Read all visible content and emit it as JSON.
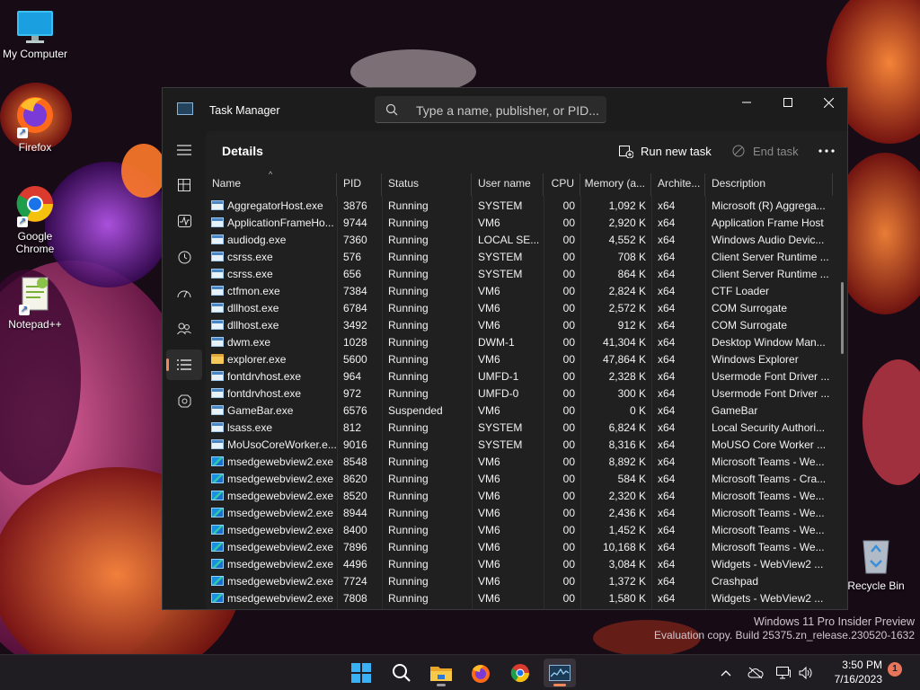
{
  "desktop": {
    "icons": [
      {
        "label": "My Computer"
      },
      {
        "label": "Firefox"
      },
      {
        "label": "Google Chrome"
      },
      {
        "label": "Notepad++"
      },
      {
        "label": "Recycle Bin"
      }
    ],
    "watermark": {
      "line1": "Windows 11 Pro Insider Preview",
      "line2": "Evaluation copy. Build 25375.zn_release.230520-1632"
    }
  },
  "window": {
    "title": "Task Manager",
    "search_placeholder": "Type a name, publisher, or PID...",
    "page_title": "Details",
    "run_new_task": "Run new task",
    "end_task": "End task",
    "accent_color": "#f08a5d"
  },
  "nav": [
    {
      "icon": "hamburger-icon"
    },
    {
      "icon": "processes-icon"
    },
    {
      "icon": "performance-icon"
    },
    {
      "icon": "app-history-icon"
    },
    {
      "icon": "startup-apps-icon"
    },
    {
      "icon": "users-icon"
    },
    {
      "icon": "details-icon",
      "active": true
    },
    {
      "icon": "services-icon"
    },
    {
      "icon": "settings-icon"
    }
  ],
  "table": {
    "columns": [
      "Name",
      "PID",
      "Status",
      "User name",
      "CPU",
      "Memory (a...",
      "Archite...",
      "Description"
    ],
    "sorted_column": "Name",
    "rows": [
      {
        "icon": "win",
        "name": "AggregatorHost.exe",
        "pid": "3876",
        "status": "Running",
        "user": "SYSTEM",
        "cpu": "00",
        "mem": "1,092 K",
        "arch": "x64",
        "desc": "Microsoft (R) Aggrega..."
      },
      {
        "icon": "win",
        "name": "ApplicationFrameHo...",
        "pid": "9744",
        "status": "Running",
        "user": "VM6",
        "cpu": "00",
        "mem": "2,920 K",
        "arch": "x64",
        "desc": "Application Frame Host"
      },
      {
        "icon": "win",
        "name": "audiodg.exe",
        "pid": "7360",
        "status": "Running",
        "user": "LOCAL SE...",
        "cpu": "00",
        "mem": "4,552 K",
        "arch": "x64",
        "desc": "Windows Audio Devic..."
      },
      {
        "icon": "win",
        "name": "csrss.exe",
        "pid": "576",
        "status": "Running",
        "user": "SYSTEM",
        "cpu": "00",
        "mem": "708 K",
        "arch": "x64",
        "desc": "Client Server Runtime ..."
      },
      {
        "icon": "win",
        "name": "csrss.exe",
        "pid": "656",
        "status": "Running",
        "user": "SYSTEM",
        "cpu": "00",
        "mem": "864 K",
        "arch": "x64",
        "desc": "Client Server Runtime ..."
      },
      {
        "icon": "win",
        "name": "ctfmon.exe",
        "pid": "7384",
        "status": "Running",
        "user": "VM6",
        "cpu": "00",
        "mem": "2,824 K",
        "arch": "x64",
        "desc": "CTF Loader"
      },
      {
        "icon": "win",
        "name": "dllhost.exe",
        "pid": "6784",
        "status": "Running",
        "user": "VM6",
        "cpu": "00",
        "mem": "2,572 K",
        "arch": "x64",
        "desc": "COM Surrogate"
      },
      {
        "icon": "win",
        "name": "dllhost.exe",
        "pid": "3492",
        "status": "Running",
        "user": "VM6",
        "cpu": "00",
        "mem": "912 K",
        "arch": "x64",
        "desc": "COM Surrogate"
      },
      {
        "icon": "win",
        "name": "dwm.exe",
        "pid": "1028",
        "status": "Running",
        "user": "DWM-1",
        "cpu": "00",
        "mem": "41,304 K",
        "arch": "x64",
        "desc": "Desktop Window Man..."
      },
      {
        "icon": "folder",
        "name": "explorer.exe",
        "pid": "5600",
        "status": "Running",
        "user": "VM6",
        "cpu": "00",
        "mem": "47,864 K",
        "arch": "x64",
        "desc": "Windows Explorer"
      },
      {
        "icon": "win",
        "name": "fontdrvhost.exe",
        "pid": "964",
        "status": "Running",
        "user": "UMFD-1",
        "cpu": "00",
        "mem": "2,328 K",
        "arch": "x64",
        "desc": "Usermode Font Driver ..."
      },
      {
        "icon": "win",
        "name": "fontdrvhost.exe",
        "pid": "972",
        "status": "Running",
        "user": "UMFD-0",
        "cpu": "00",
        "mem": "300 K",
        "arch": "x64",
        "desc": "Usermode Font Driver ..."
      },
      {
        "icon": "win",
        "name": "GameBar.exe",
        "pid": "6576",
        "status": "Suspended",
        "user": "VM6",
        "cpu": "00",
        "mem": "0 K",
        "arch": "x64",
        "desc": "GameBar"
      },
      {
        "icon": "win",
        "name": "lsass.exe",
        "pid": "812",
        "status": "Running",
        "user": "SYSTEM",
        "cpu": "00",
        "mem": "6,824 K",
        "arch": "x64",
        "desc": "Local Security Authori..."
      },
      {
        "icon": "win",
        "name": "MoUsoCoreWorker.e...",
        "pid": "9016",
        "status": "Running",
        "user": "SYSTEM",
        "cpu": "00",
        "mem": "8,316 K",
        "arch": "x64",
        "desc": "MoUSO Core Worker ..."
      },
      {
        "icon": "edge",
        "name": "msedgewebview2.exe",
        "pid": "8548",
        "status": "Running",
        "user": "VM6",
        "cpu": "00",
        "mem": "8,892 K",
        "arch": "x64",
        "desc": "Microsoft Teams - We..."
      },
      {
        "icon": "edge",
        "name": "msedgewebview2.exe",
        "pid": "8620",
        "status": "Running",
        "user": "VM6",
        "cpu": "00",
        "mem": "584 K",
        "arch": "x64",
        "desc": "Microsoft Teams - Cra..."
      },
      {
        "icon": "edge",
        "name": "msedgewebview2.exe",
        "pid": "8520",
        "status": "Running",
        "user": "VM6",
        "cpu": "00",
        "mem": "2,320 K",
        "arch": "x64",
        "desc": "Microsoft Teams - We..."
      },
      {
        "icon": "edge",
        "name": "msedgewebview2.exe",
        "pid": "8944",
        "status": "Running",
        "user": "VM6",
        "cpu": "00",
        "mem": "2,436 K",
        "arch": "x64",
        "desc": "Microsoft Teams - We..."
      },
      {
        "icon": "edge",
        "name": "msedgewebview2.exe",
        "pid": "8400",
        "status": "Running",
        "user": "VM6",
        "cpu": "00",
        "mem": "1,452 K",
        "arch": "x64",
        "desc": "Microsoft Teams - We..."
      },
      {
        "icon": "edge",
        "name": "msedgewebview2.exe",
        "pid": "7896",
        "status": "Running",
        "user": "VM6",
        "cpu": "00",
        "mem": "10,168 K",
        "arch": "x64",
        "desc": "Microsoft Teams - We..."
      },
      {
        "icon": "edge",
        "name": "msedgewebview2.exe",
        "pid": "4496",
        "status": "Running",
        "user": "VM6",
        "cpu": "00",
        "mem": "3,084 K",
        "arch": "x64",
        "desc": "Widgets - WebView2 ..."
      },
      {
        "icon": "edge",
        "name": "msedgewebview2.exe",
        "pid": "7724",
        "status": "Running",
        "user": "VM6",
        "cpu": "00",
        "mem": "1,372 K",
        "arch": "x64",
        "desc": "Crashpad"
      },
      {
        "icon": "edge",
        "name": "msedgewebview2.exe",
        "pid": "7808",
        "status": "Running",
        "user": "VM6",
        "cpu": "00",
        "mem": "1,580 K",
        "arch": "x64",
        "desc": "Widgets - WebView2 ..."
      }
    ]
  },
  "taskbar": {
    "apps": [
      "start-icon",
      "search-icon",
      "file-explorer-icon",
      "firefox-icon",
      "chrome-icon",
      "task-manager-icon"
    ],
    "time": "3:50 PM",
    "date": "7/16/2023",
    "notification_count": "1"
  }
}
